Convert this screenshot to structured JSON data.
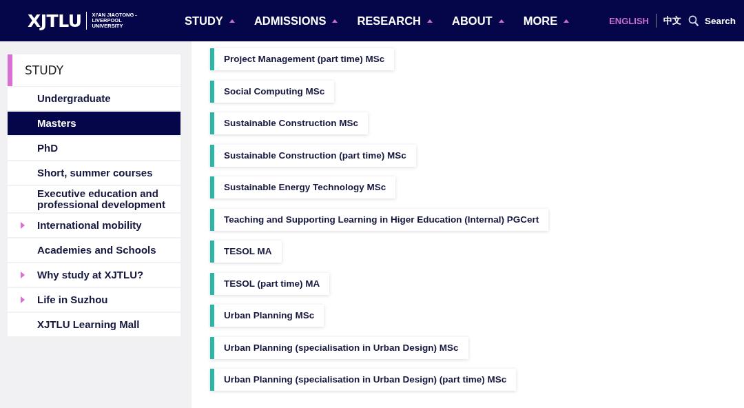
{
  "header": {
    "logo": "XJTLU",
    "logo_subtitle_1": "XI'AN JIAOTONG -",
    "logo_subtitle_2": "LIVERPOOL UNIVERSITY",
    "nav": [
      {
        "label": "STUDY"
      },
      {
        "label": "ADMISSIONS"
      },
      {
        "label": "RESEARCH"
      },
      {
        "label": "ABOUT"
      },
      {
        "label": "MORE"
      }
    ],
    "languages": [
      {
        "label": "ENGLISH",
        "selected": true
      },
      {
        "label": "中文",
        "selected": false
      }
    ],
    "search": "Search"
  },
  "sidebar": {
    "title": "STUDY",
    "items": [
      {
        "label": "Undergraduate",
        "selected": false,
        "has_children": false
      },
      {
        "label": "Masters",
        "selected": true,
        "has_children": false
      },
      {
        "label": "PhD",
        "selected": false,
        "has_children": false
      },
      {
        "label": "Short, summer courses",
        "selected": false,
        "has_children": false
      },
      {
        "label": "Executive education and professional development",
        "selected": false,
        "has_children": false
      },
      {
        "label": "International mobility",
        "selected": false,
        "has_children": true
      },
      {
        "label": "Academies and Schools",
        "selected": false,
        "has_children": false
      },
      {
        "label": "Why study at XJTLU?",
        "selected": false,
        "has_children": true
      },
      {
        "label": "Life in Suzhou",
        "selected": false,
        "has_children": true
      },
      {
        "label": "XJTLU Learning Mall",
        "selected": false,
        "has_children": false
      }
    ]
  },
  "programmes": [
    "Project Management (part time) MSc",
    "Social Computing MSc",
    "Sustainable Construction MSc",
    "Sustainable Construction (part time) MSc",
    "Sustainable Energy Technology MSc",
    "Teaching and Supporting Learning in Higer Education (Internal) PGCert",
    "TESOL MA",
    "TESOL (part time) MA",
    "Urban Planning MSc",
    "Urban Planning (specialisation in Urban Design) MSc",
    "Urban Planning (specialisation in Urban Design) (part time) MSc"
  ]
}
